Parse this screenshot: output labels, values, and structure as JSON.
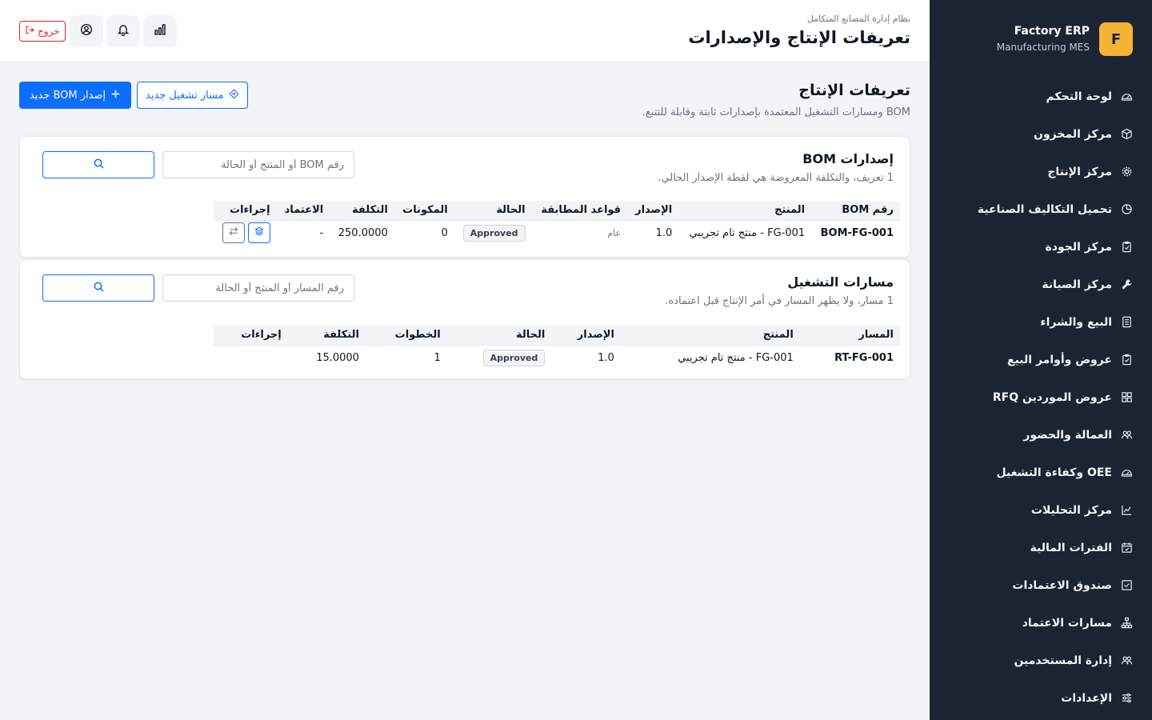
{
  "brand": {
    "logo_letter": "F",
    "title": "Factory ERP",
    "subtitle": "Manufacturing MES",
    "accent": "#f5b335"
  },
  "sidebar": {
    "items": [
      {
        "label": "لوحة التحكم",
        "icon": "speedometer-icon"
      },
      {
        "label": "مركز المخزون",
        "icon": "box-icon"
      },
      {
        "label": "مركز الإنتاج",
        "icon": "gear-icon"
      },
      {
        "label": "تحميل التكاليف الصناعية",
        "icon": "pie-chart-icon"
      },
      {
        "label": "مركز الجودة",
        "icon": "clipboard-check-icon"
      },
      {
        "label": "مركز الصيانة",
        "icon": "wrench-icon"
      },
      {
        "label": "البيع والشراء",
        "icon": "receipt-icon"
      },
      {
        "label": "عروض وأوامر البيع",
        "icon": "clipboard-icon"
      },
      {
        "label": "عروض الموردين RFQ",
        "icon": "grid-icon"
      },
      {
        "label": "العمالة والحضور",
        "icon": "people-icon"
      },
      {
        "label": "OEE وكفاءة التشغيل",
        "icon": "gauge-icon"
      },
      {
        "label": "مركز التحليلات",
        "icon": "graph-up-icon"
      },
      {
        "label": "الفترات المالية",
        "icon": "calendar-check-icon"
      },
      {
        "label": "صندوق الاعتمادات",
        "icon": "check-square-icon"
      },
      {
        "label": "مسارات الاعتماد",
        "icon": "diagram-icon"
      },
      {
        "label": "إدارة المستخدمين",
        "icon": "people-icon"
      },
      {
        "label": "الإعدادات",
        "icon": "sliders-icon"
      }
    ]
  },
  "header": {
    "subtitle": "نظام إدارة المصانع المتكامل",
    "title": "تعريفات الإنتاج والإصدارات",
    "logout_label": "خروج"
  },
  "page": {
    "heading": "تعريفات الإنتاج",
    "description": "BOM ومسارات التشغيل المعتمدة بإصدارات ثابتة وقابلة للتتبع.",
    "new_bom_label": "إصدار BOM جديد",
    "new_route_label": "مسار تشغيل جديد",
    "primary_color": "#0d6efd"
  },
  "bom": {
    "title": "إصدارات BOM",
    "description": "1 تعريف، والتكلفة المعروضة هي لقطة الإصدار الحالي.",
    "search_placeholder": "رقم BOM أو المنتج أو الحالة",
    "columns": {
      "code": "رقم BOM",
      "product": "المنتج",
      "version": "الإصدار",
      "rules": "قواعد المطابقة",
      "status": "الحالة",
      "components": "المكونات",
      "cost": "التكلفة",
      "approval": "الاعتماد",
      "actions": "إجراءات"
    },
    "rows": [
      {
        "code": "BOM-FG-001",
        "product": "FG-001 - منتج تام تجريبي",
        "version": "1.0",
        "rules": "عام",
        "status": "Approved",
        "components": "0",
        "cost": "250.0000",
        "approval": "-"
      }
    ]
  },
  "routes": {
    "title": "مسارات التشغيل",
    "description": "1 مسار، ولا يظهر المسار في أمر الإنتاج قبل اعتماده.",
    "search_placeholder": "رقم المسار أو المنتج أو الحالة",
    "columns": {
      "code": "المسار",
      "product": "المنتج",
      "version": "الإصدار",
      "status": "الحالة",
      "steps": "الخطوات",
      "cost": "التكلفة",
      "actions": "إجراءات"
    },
    "rows": [
      {
        "code": "RT-FG-001",
        "product": "FG-001 - منتج تام تجريبي",
        "version": "1.0",
        "status": "Approved",
        "steps": "1",
        "cost": "15.0000"
      }
    ]
  }
}
